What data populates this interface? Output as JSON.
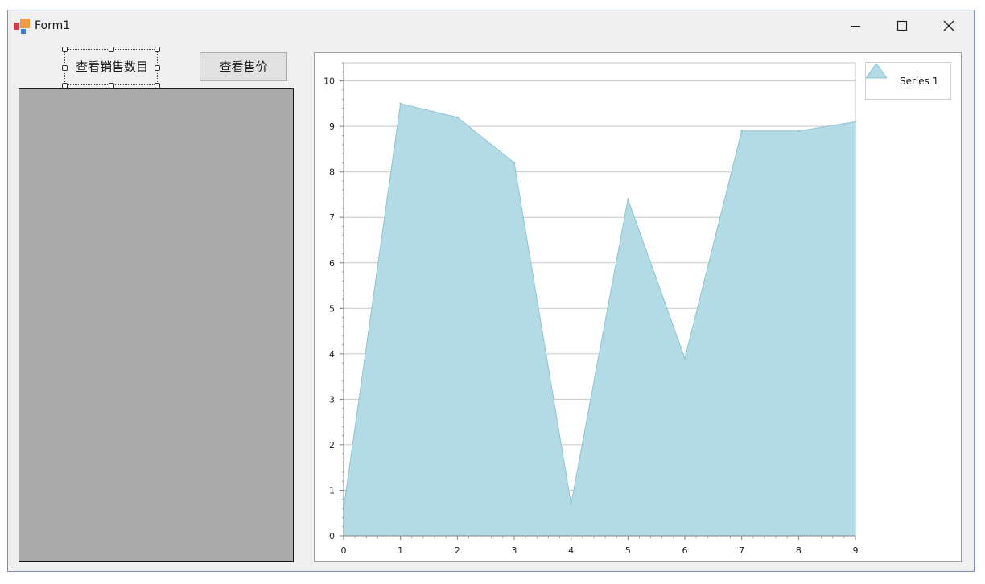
{
  "window": {
    "title": "Form1"
  },
  "buttons": {
    "view_sales_qty": "查看销售数目",
    "view_price": "查看售价"
  },
  "colors": {
    "area_fill": "#b3dbe5",
    "area_stroke": "#8fc3d2",
    "grid": "#c8c8c8"
  },
  "chart_data": {
    "type": "area",
    "x": [
      0,
      1,
      2,
      3,
      4,
      5,
      6,
      7,
      8,
      9
    ],
    "series": [
      {
        "name": "Series 1",
        "values": [
          0.6,
          9.5,
          9.2,
          8.2,
          0.7,
          7.4,
          3.9,
          8.9,
          8.9,
          9.1
        ]
      }
    ],
    "xlim": [
      0,
      9
    ],
    "ylim": [
      0,
      10.4
    ],
    "xticks": [
      0,
      1,
      2,
      3,
      4,
      5,
      6,
      7,
      8,
      9
    ],
    "yticks": [
      0,
      1,
      2,
      3,
      4,
      5,
      6,
      7,
      8,
      9,
      10
    ],
    "grid": true,
    "legend_position": "top-right"
  }
}
